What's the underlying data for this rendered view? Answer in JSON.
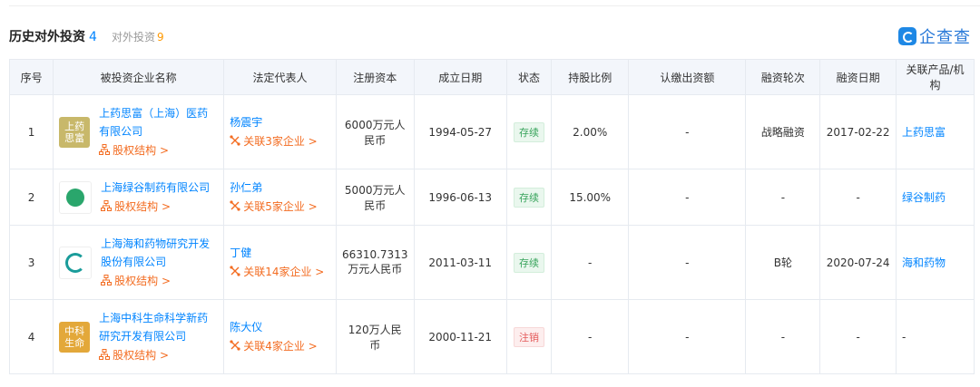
{
  "header": {
    "title": "历史对外投资",
    "title_count": "4",
    "subtab": "对外投资",
    "subtab_count": "9",
    "logo_text": "企查查"
  },
  "columns": [
    "序号",
    "被投资企业名称",
    "法定代表人",
    "注册资本",
    "成立日期",
    "状态",
    "持股比例",
    "认缴出资额",
    "融资轮次",
    "融资日期",
    "关联产品/机构"
  ],
  "rows": [
    {
      "index": "1",
      "logo_text": "上药思富",
      "logo_color": "#c8b86a",
      "company_line1": "上药思富（上海）医药",
      "company_line2": "有限公司",
      "equity": "股权结构 >",
      "person": "杨震宇",
      "related": "关联3家企业 >",
      "capital_line1": "6000万元人",
      "capital_line2": "民币",
      "date": "1994-05-27",
      "status": "存续",
      "status_type": "ok",
      "share": "2.00%",
      "subscribed": "-",
      "round": "战略融资",
      "fin_date": "2017-02-22",
      "product": "上药思富"
    },
    {
      "index": "2",
      "logo_text": "",
      "logo_color": "#2aa66c",
      "company_line1": "上海绿谷制药有限公司",
      "company_line2": "",
      "equity": "股权结构 >",
      "person": "孙仁弟",
      "related": "关联5家企业 >",
      "capital_line1": "5000万元人",
      "capital_line2": "民币",
      "date": "1996-06-13",
      "status": "存续",
      "status_type": "ok",
      "share": "15.00%",
      "subscribed": "-",
      "round": "-",
      "fin_date": "-",
      "product": "绿谷制药"
    },
    {
      "index": "3",
      "logo_text": "",
      "logo_color": "#1a9c9a",
      "company_line1": "上海海和药物研究开发",
      "company_line2": "股份有限公司",
      "equity": "股权结构 >",
      "person": "丁健",
      "related": "关联14家企业 >",
      "capital_line1": "66310.7313",
      "capital_line2": "万元人民币",
      "date": "2011-03-11",
      "status": "存续",
      "status_type": "ok",
      "share": "-",
      "subscribed": "-",
      "round": "B轮",
      "fin_date": "2020-07-24",
      "product": "海和药物"
    },
    {
      "index": "4",
      "logo_text": "中科生命",
      "logo_color": "#e3a83a",
      "company_line1": "上海中科生命科学新药",
      "company_line2": "研究开发有限公司",
      "equity": "股权结构 >",
      "person": "陈大仪",
      "related": "关联4家企业 >",
      "capital_line1": "120万人民",
      "capital_line2": "币",
      "date": "2000-11-21",
      "status": "注销",
      "status_type": "bad",
      "share": "-",
      "subscribed": "-",
      "round": "-",
      "fin_date": "-",
      "product": "-"
    }
  ]
}
